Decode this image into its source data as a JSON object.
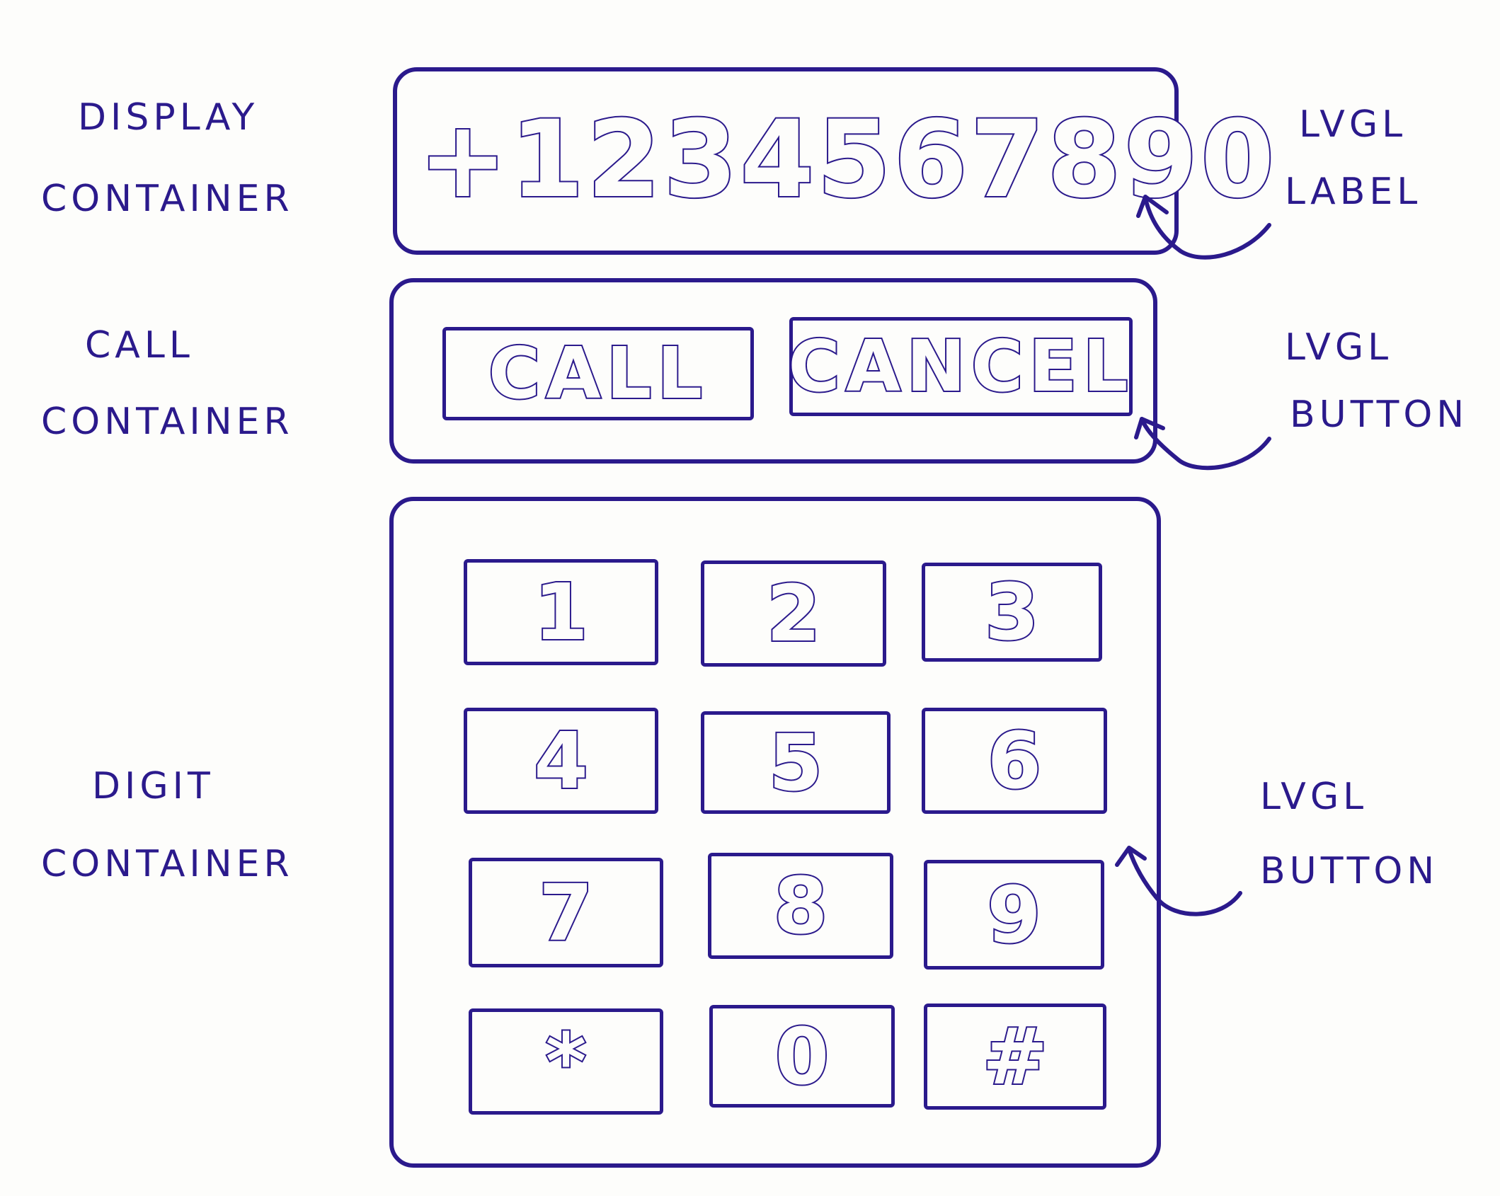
{
  "annotations": {
    "display_container": [
      "Display",
      "Container"
    ],
    "call_container": [
      "Call",
      "Container"
    ],
    "digit_container": [
      "Digit",
      "Container"
    ],
    "lvgl_label": [
      "LVGL",
      "Label"
    ],
    "lvgl_button_call": [
      "LVGL",
      "Button"
    ],
    "lvgl_button_digit": [
      "LVGL",
      "Button"
    ]
  },
  "display": {
    "value": "+1234567890"
  },
  "call_container": {
    "call_label": "CALL",
    "cancel_label": "CANCEL"
  },
  "digit_container": {
    "keys": [
      "1",
      "2",
      "3",
      "4",
      "5",
      "6",
      "7",
      "8",
      "9",
      "*",
      "0",
      "#"
    ]
  },
  "colors": {
    "ink": "#2b1a8c",
    "paper": "#fdfdfb"
  }
}
